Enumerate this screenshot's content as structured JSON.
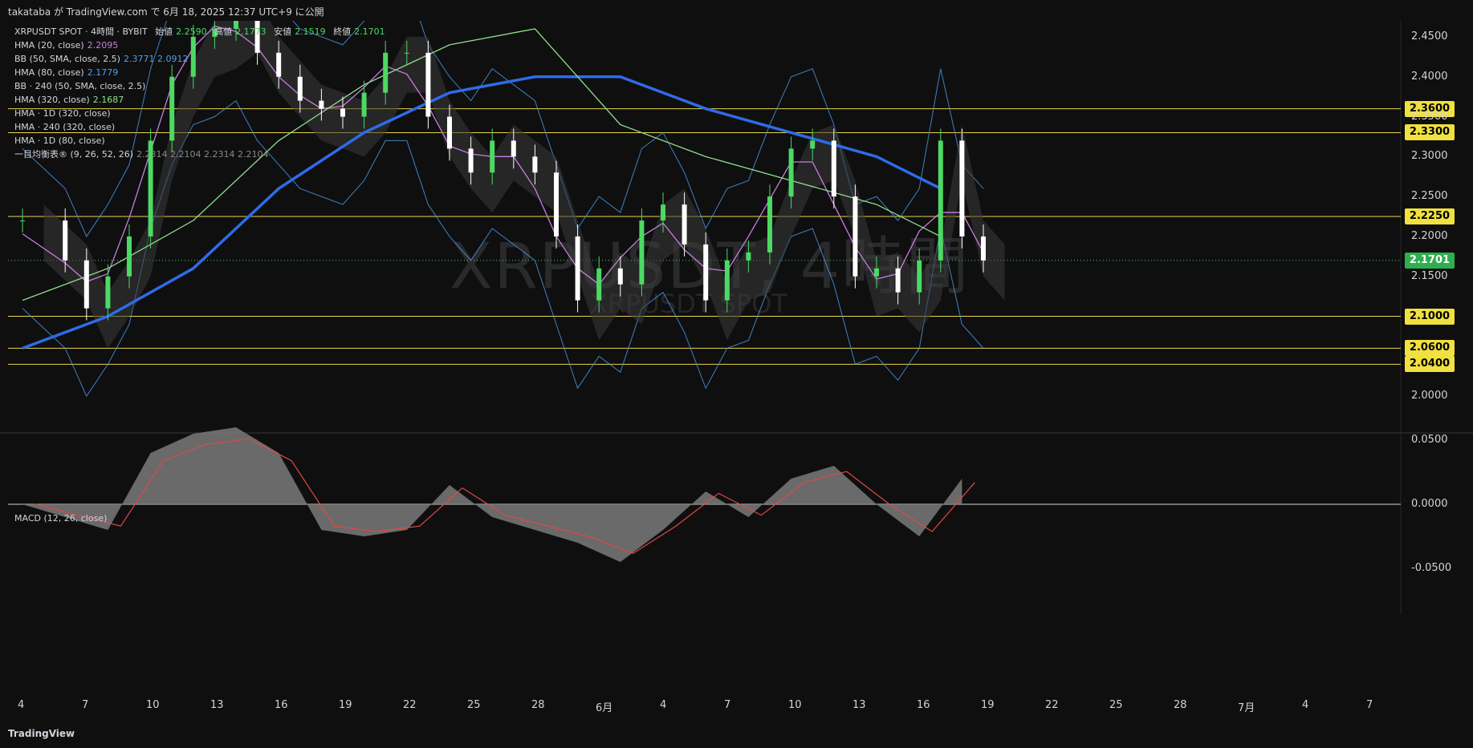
{
  "header": {
    "publish_text": "takataba が TradingView.com で 6月 18, 2025 12:37 UTC+9 に公開"
  },
  "watermark": {
    "symbol_tf": "XRPUSDT, 4時間",
    "subtitle": "XRPUSDT SPOT"
  },
  "legend": {
    "main": {
      "label": "XRPUSDT SPOT · 4時間 · BYBIT",
      "open_label": "始値",
      "open": "2.2590",
      "high_label": "高値",
      "high": "2.1773",
      "low_label": "安値",
      "low": "2.1519",
      "close_label": "終値",
      "close": "2.1701"
    },
    "lines": [
      {
        "label": "HMA (20, close)",
        "value": "2.2095",
        "color": "#c77fe0"
      },
      {
        "label": "BB (50, SMA, close, 2.5)",
        "value": "2.3771  2.0912",
        "color": "#4c9ef0"
      },
      {
        "label": "HMA (80, close)",
        "value": "2.1779",
        "color": "#4c9ef0"
      },
      {
        "label": "BB · 240 (50, SMA, close, 2.5)",
        "value": "",
        "color": "#4c9ef0"
      },
      {
        "label": "HMA (320, close)",
        "value": "2.1687",
        "color": "#8ee08e"
      },
      {
        "label": "HMA · 1D (320, close)",
        "value": "",
        "color": "#ffffff"
      },
      {
        "label": "HMA · 240 (320, close)",
        "value": "",
        "color": "#ffffff"
      },
      {
        "label": "HMA · 1D (80, close)",
        "value": "",
        "color": "#ffffff"
      },
      {
        "label": "一目均衡表® (9, 26, 52, 26)",
        "value": "2.2314  2.2104  2.2314  2.2104",
        "color": "#888888"
      }
    ]
  },
  "price_axis": {
    "ticks": [
      "2.4500",
      "2.4000",
      "2.3500",
      "2.3000",
      "2.2500",
      "2.2000",
      "2.1500",
      "2.0000"
    ],
    "levels": [
      {
        "label": "2.3600",
        "value": 2.36
      },
      {
        "label": "2.3300",
        "value": 2.33
      },
      {
        "label": "2.2250",
        "value": 2.225
      },
      {
        "label": "2.1000",
        "value": 2.1
      },
      {
        "label": "2.0600",
        "value": 2.06
      },
      {
        "label": "2.0400",
        "value": 2.04
      }
    ],
    "current": {
      "label": "2.1701",
      "value": 2.1701
    }
  },
  "macd": {
    "title": "MACD (12, 26, close)",
    "ticks": [
      "0.0500",
      "0.0000",
      "-0.0500"
    ]
  },
  "time_axis": {
    "labels": [
      "4",
      "7",
      "10",
      "13",
      "16",
      "19",
      "22",
      "25",
      "28",
      "6月",
      "4",
      "7",
      "10",
      "13",
      "16",
      "19",
      "22",
      "25",
      "28",
      "7月",
      "4",
      "7"
    ]
  },
  "footer": {
    "brand": "TradingView"
  },
  "colors": {
    "background": "#0f0f0f",
    "bull_candle": "#4cd964",
    "bear_candle": "#ffffff",
    "level_line": "#e8d44d",
    "hma320": "#2f6be8",
    "current_price": "#2eaf4e",
    "macd_hist": "#7a7a7a",
    "macd_signal": "#e04848"
  },
  "chart_data": {
    "type": "line",
    "title": "XRPUSDT SPOT · 4時間 · BYBIT",
    "ylim": [
      1.96,
      2.47
    ],
    "x_range_days": [
      4,
      50
    ],
    "candles_close_series": {
      "name": "",
      "x": [
        4,
        6,
        7,
        8,
        9,
        10,
        11,
        12,
        13,
        14,
        15,
        16,
        17,
        18,
        19,
        20,
        21,
        22,
        23,
        24,
        25,
        26,
        27,
        28,
        29,
        30,
        31,
        32,
        33,
        34,
        35,
        36,
        37,
        38,
        39,
        40,
        41,
        42,
        43,
        44,
        45,
        46,
        47,
        48,
        49
      ],
      "values": [
        2.22,
        2.17,
        2.11,
        2.15,
        2.2,
        2.32,
        2.4,
        2.45,
        2.46,
        2.48,
        2.43,
        2.4,
        2.37,
        2.36,
        2.35,
        2.38,
        2.43,
        2.43,
        2.35,
        2.31,
        2.28,
        2.32,
        2.3,
        2.28,
        2.2,
        2.12,
        2.16,
        2.14,
        2.22,
        2.24,
        2.19,
        2.12,
        2.17,
        2.18,
        2.25,
        2.31,
        2.32,
        2.25,
        2.15,
        2.16,
        2.13,
        2.17,
        2.32,
        2.2,
        2.17
      ]
    },
    "hma320_series": {
      "name": "",
      "x": [
        4,
        8,
        12,
        16,
        20,
        24,
        28,
        32,
        36,
        40,
        44,
        47
      ],
      "values": [
        2.06,
        2.1,
        2.16,
        2.26,
        2.33,
        2.38,
        2.4,
        2.4,
        2.36,
        2.33,
        2.3,
        2.26
      ]
    },
    "macd_series": {
      "name": "",
      "x": [
        4,
        6,
        8,
        10,
        12,
        14,
        16,
        18,
        20,
        22,
        24,
        26,
        28,
        30,
        32,
        34,
        36,
        38,
        40,
        42,
        44,
        46,
        48
      ],
      "values": [
        0.0,
        -0.01,
        -0.02,
        0.04,
        0.055,
        0.06,
        0.04,
        -0.02,
        -0.025,
        -0.02,
        0.015,
        -0.01,
        -0.02,
        -0.03,
        -0.045,
        -0.02,
        0.01,
        -0.01,
        0.02,
        0.03,
        0.0,
        -0.025,
        0.02
      ]
    }
  }
}
